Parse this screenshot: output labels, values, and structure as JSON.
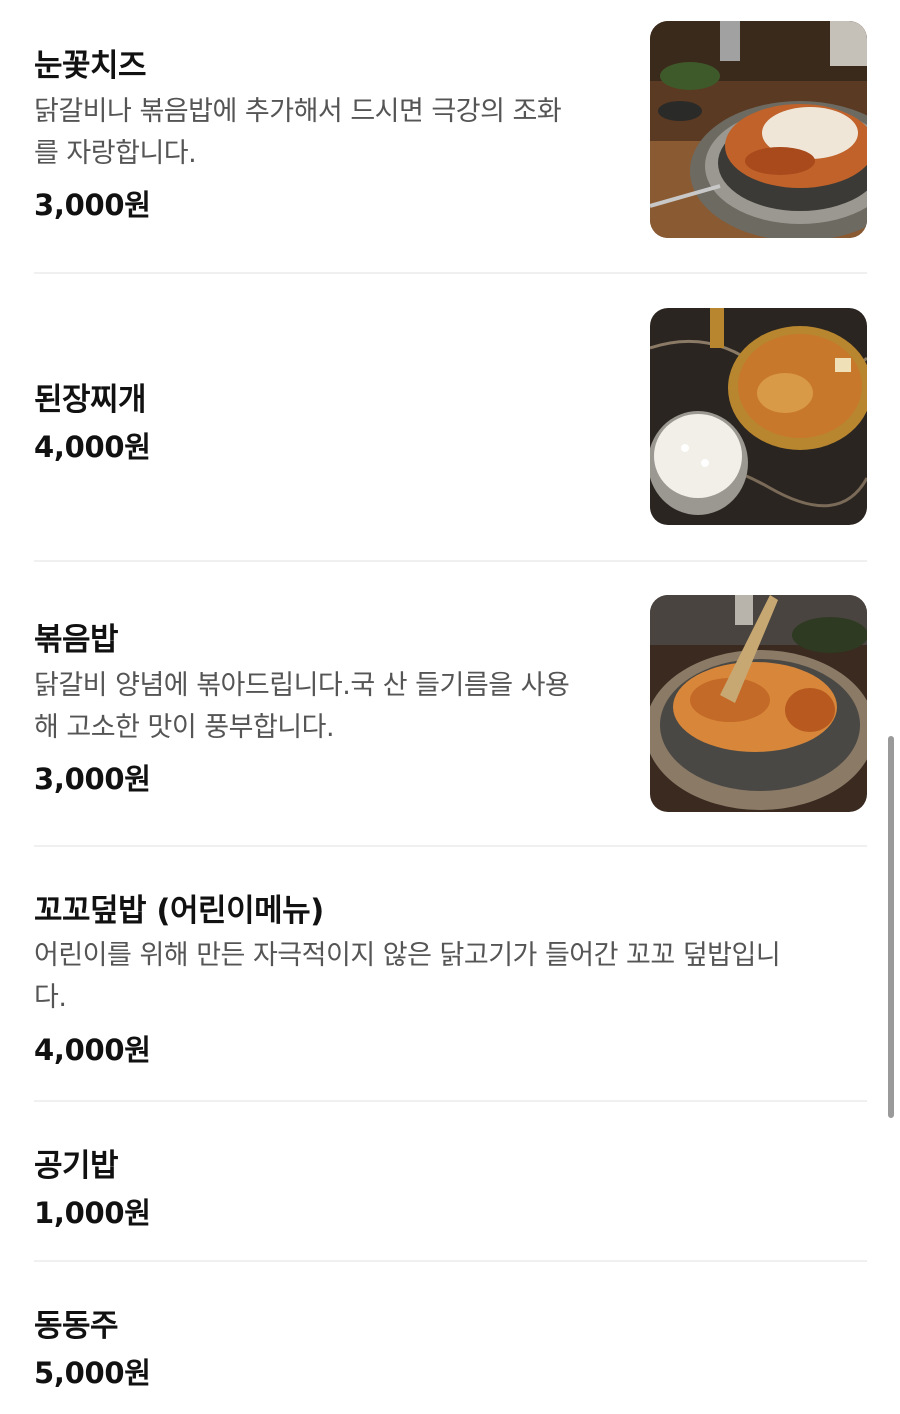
{
  "menu": {
    "items": [
      {
        "name": "눈꽃치즈",
        "desc_lines": [
          "닭갈비나 볶음밥에 추가해서 드시면 극강의 조화",
          "를 자랑합니다."
        ],
        "price": "3,000원",
        "image_icon": "snow-cheese-dish-photo"
      },
      {
        "name": "된장찌개",
        "desc_lines": [],
        "price": "4,000원",
        "image_icon": "doenjang-stew-photo"
      },
      {
        "name": "볶음밥",
        "desc_lines": [
          "닭갈비 양념에 볶아드립니다.국 산 들기름을 사용",
          "해 고소한 맛이 풍부합니다."
        ],
        "price": "3,000원",
        "image_icon": "fried-rice-photo"
      },
      {
        "name": "꼬꼬덮밥 (어린이메뉴)",
        "desc_lines": [
          "어린이를 위해 만든 자극적이지 않은 닭고기가 들어간 꼬꼬 덮밥입니",
          "다."
        ],
        "price": "4,000원"
      },
      {
        "name": "공기밥",
        "desc_lines": [],
        "price": "1,000원"
      },
      {
        "name": "동동주",
        "desc_lines": [],
        "price": "5,000원"
      }
    ]
  },
  "colors": {
    "text_primary": "#111111",
    "text_secondary": "#555555",
    "divider": "#f0f0f0",
    "scrollbar": "#9a9a9a"
  }
}
